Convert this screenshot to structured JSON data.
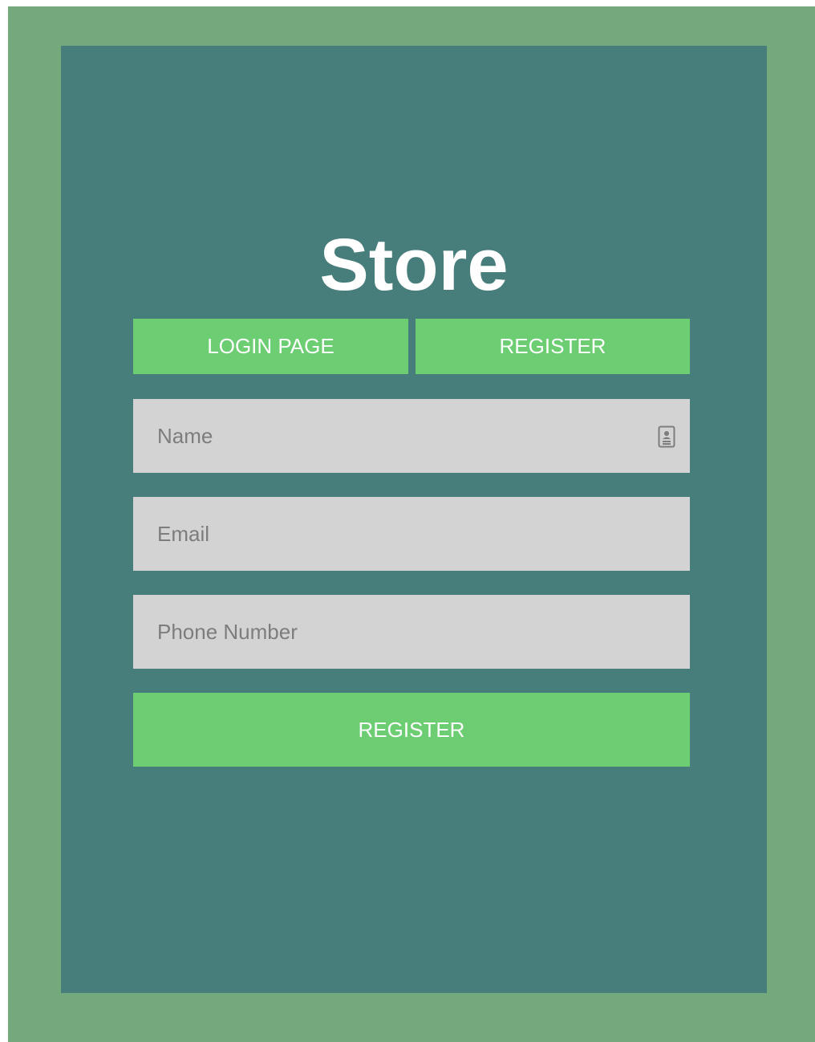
{
  "app": {
    "title": "Store"
  },
  "tabs": {
    "login_label": "LOGIN PAGE",
    "register_label": "REGISTER"
  },
  "form": {
    "name": {
      "placeholder": "Name",
      "value": "",
      "icon": "contact-card-icon"
    },
    "email": {
      "placeholder": "Email",
      "value": ""
    },
    "phone": {
      "placeholder": "Phone Number",
      "value": ""
    },
    "submit_label": "REGISTER"
  },
  "colors": {
    "outer_background": "#74a97b",
    "panel_background": "#477d7b",
    "accent_green": "#6ccd72",
    "input_background": "#d3d3d3",
    "text_white": "#ffffff"
  }
}
